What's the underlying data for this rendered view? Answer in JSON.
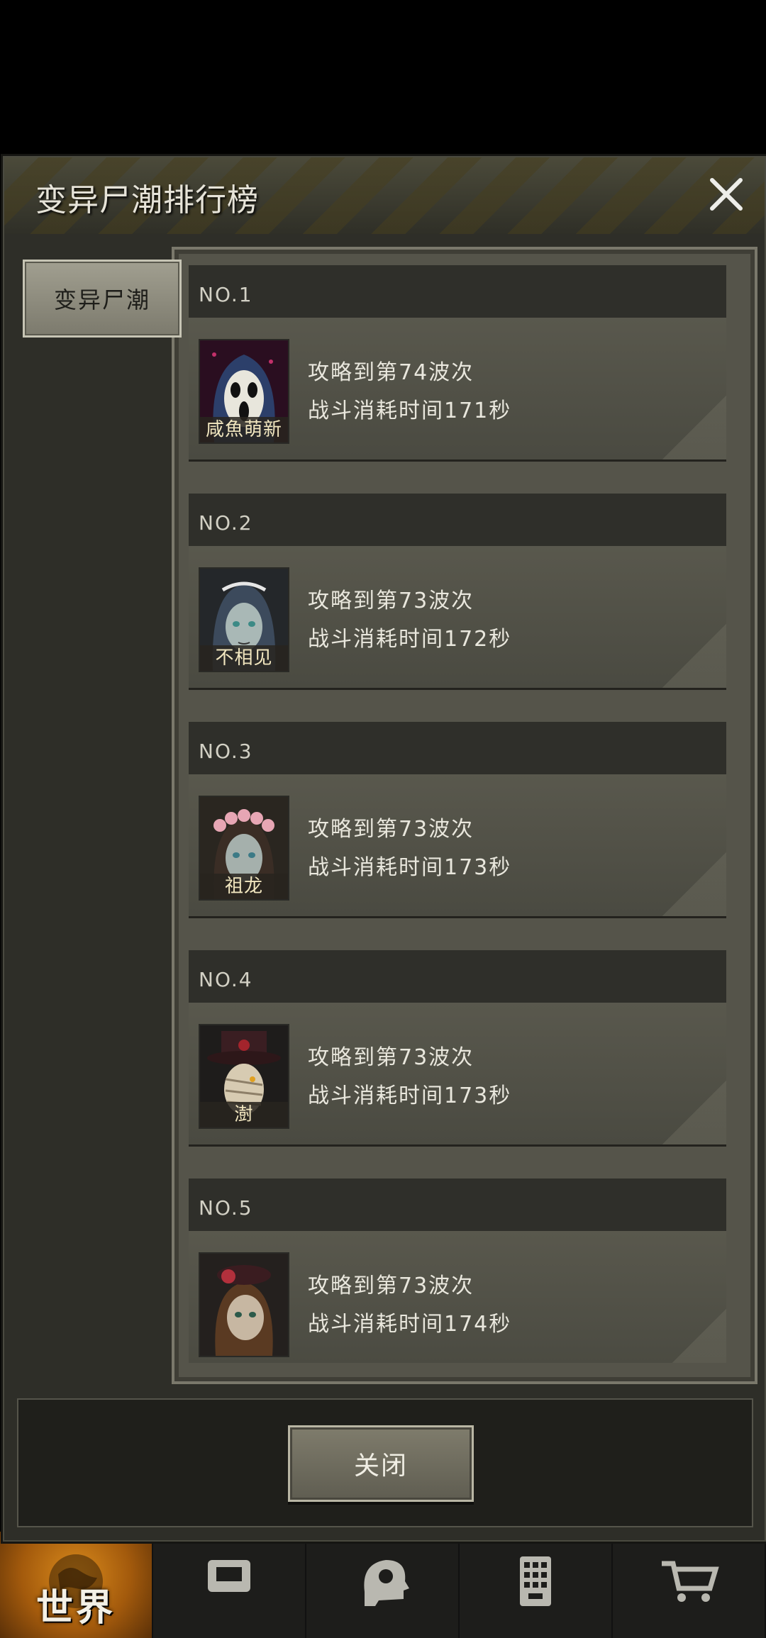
{
  "dialog": {
    "title": "变异尸潮排行榜",
    "side_tab": "变异尸潮",
    "close_button": "关闭"
  },
  "ranks": [
    {
      "rank": "NO.1",
      "name": "咸魚萌新",
      "line1": "攻略到第74波次",
      "line2": "战斗消耗时间171秒",
      "avatar": "ghost-mask-avatar"
    },
    {
      "rank": "NO.2",
      "name": "不相见",
      "line1": "攻略到第73波次",
      "line2": "战斗消耗时间172秒",
      "avatar": "maid-girl-avatar"
    },
    {
      "rank": "NO.3",
      "name": "祖龙",
      "line1": "攻略到第73波次",
      "line2": "战斗消耗时间173秒",
      "avatar": "flower-crown-girl-avatar"
    },
    {
      "rank": "NO.4",
      "name": "澍",
      "line1": "攻略到第73波次",
      "line2": "战斗消耗时间173秒",
      "avatar": "bandaged-top-hat-avatar"
    },
    {
      "rank": "NO.5",
      "name": "",
      "line1": "攻略到第73波次",
      "line2": "战斗消耗时间174秒",
      "avatar": "rose-hat-girl-avatar"
    }
  ],
  "bottom_nav": {
    "world_label": "世界",
    "items": [
      "globe-icon",
      "backpack-icon",
      "head-gear-icon",
      "building-icon",
      "cart-icon"
    ]
  }
}
